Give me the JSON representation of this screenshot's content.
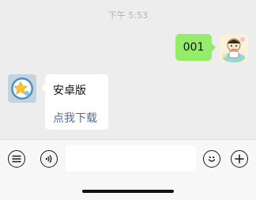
{
  "timestamp": "下午 5:53",
  "outgoing_message": {
    "text": "001",
    "bubble_color": "#95ec69"
  },
  "incoming_card": {
    "title": "安卓版",
    "link_label": "点我下载",
    "link_color": "#576b95"
  },
  "toolbar": {
    "left_icons": [
      "list-icon",
      "voice-icon"
    ],
    "right_icons": [
      "emoji-icon",
      "plus-icon"
    ],
    "input_value": ""
  },
  "colors": {
    "chat_background": "#ededed",
    "toolbar_background": "#f7f7f7"
  }
}
